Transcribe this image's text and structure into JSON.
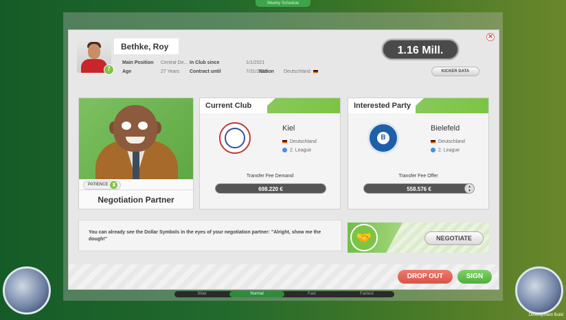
{
  "background": {
    "top_chip": "Weekly Schedule",
    "speed_options": [
      "Slow",
      "Normal",
      "Fast",
      "Fastest"
    ],
    "dev_build": "Development Build"
  },
  "player": {
    "name": "Bethke, Roy",
    "badge": "7",
    "main_position_label": "Main Position",
    "main_position": "Central De...",
    "in_club_since_label": "In Club since",
    "in_club_since": "1/1/2021",
    "age_label": "Age",
    "age": "27 Years",
    "contract_until_label": "Contract until",
    "contract_until": "7/31/2023",
    "nation_label": "Nation",
    "nation": "Deutschland"
  },
  "value": "1.16 Mill.",
  "kicker_button": "KICKER DATA",
  "partner": {
    "patience_label": "PATIENCE",
    "patience_icon": "hourglass-icon",
    "label": "Negotiation Partner"
  },
  "current_club": {
    "title": "Current Club",
    "name": "Kiel",
    "country": "Deutschland",
    "league": "2. League",
    "fee_label": "Transfer Fee Demand",
    "fee": "698.220 €"
  },
  "interested_party": {
    "title": "Interested Party",
    "name": "Bielefeld",
    "country": "Deutschland",
    "league": "2. League",
    "fee_label": "Transfer Fee Offer",
    "fee": "558.576 €"
  },
  "quote": "You can already see the Dollar Symbols in the eyes of your negotiation partner: \"Alright, show me the dough!\"",
  "negotiate_button": "NEGOTIATE",
  "dropout_button": "DROP OUT",
  "sign_button": "SIGN",
  "colors": {
    "accent_green": "#7cc445",
    "danger_red": "#d75447",
    "pill_dark": "#4a4a4a"
  }
}
